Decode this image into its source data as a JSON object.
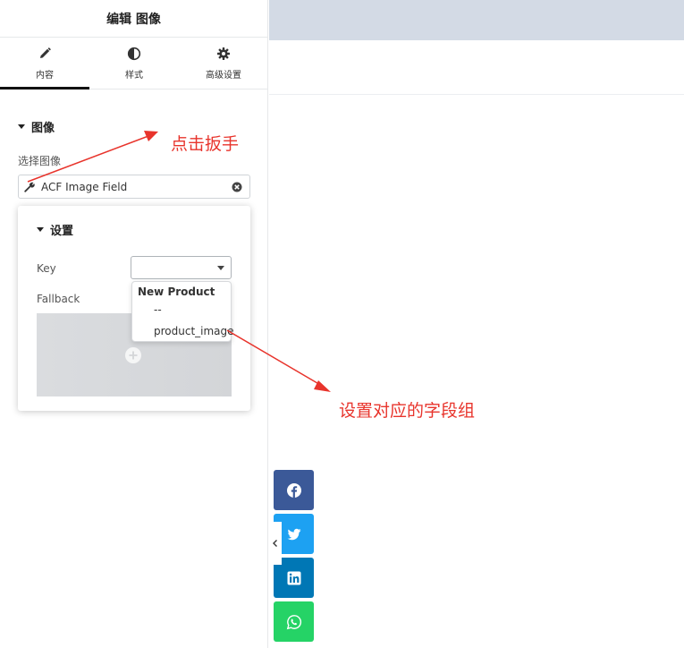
{
  "panel": {
    "title": "编辑 图像"
  },
  "tabs": [
    {
      "label": "内容",
      "icon": "pencil-icon",
      "active": true
    },
    {
      "label": "样式",
      "icon": "half-circle-icon",
      "active": false
    },
    {
      "label": "高级设置",
      "icon": "gear-icon",
      "active": false
    }
  ],
  "image_section": {
    "title": "图像",
    "select_label": "选择图像",
    "dynamic_value": "ACF Image Field"
  },
  "settings_popover": {
    "title": "设置",
    "key_label": "Key",
    "key_value": "",
    "fallback_label": "Fallback"
  },
  "key_dropdown": {
    "group": "New Product",
    "options": [
      "--",
      "product_image"
    ]
  },
  "annotations": {
    "click_wrench": "点击扳手",
    "set_field_group": "设置对应的字段组"
  },
  "share_buttons": [
    {
      "name": "facebook",
      "color": "#3b5998"
    },
    {
      "name": "twitter",
      "color": "#1da1f2"
    },
    {
      "name": "linkedin",
      "color": "#0077b5"
    },
    {
      "name": "whatsapp",
      "color": "#25d366"
    }
  ],
  "colors": {
    "annotation": "#e8342c",
    "preview_header": "#d3dae5"
  }
}
